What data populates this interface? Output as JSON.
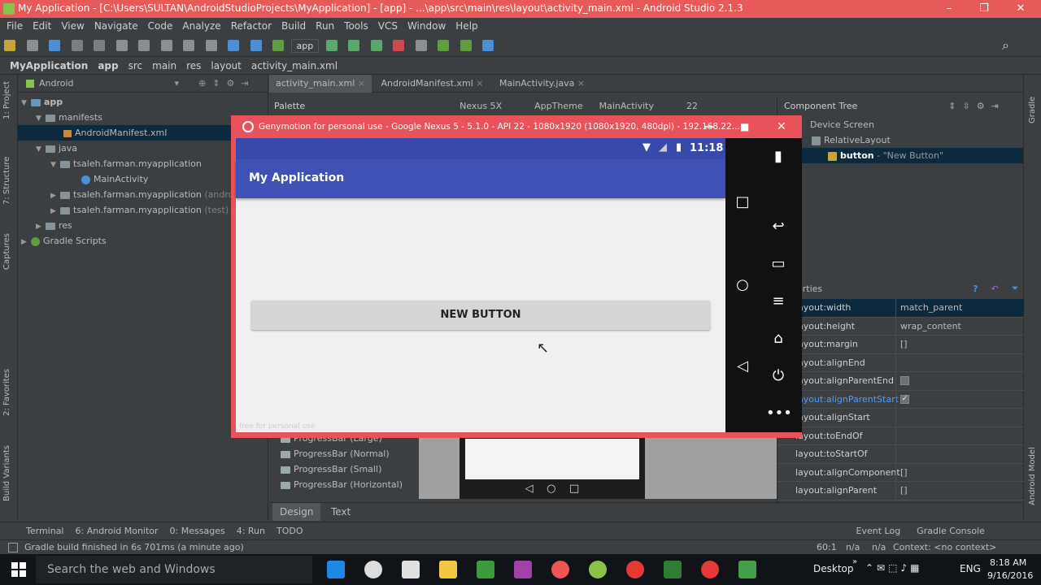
{
  "window": {
    "title": "My Application - [C:\\Users\\SULTAN\\AndroidStudioProjects\\MyApplication] - [app] - ...\\app\\src\\main\\res\\layout\\activity_main.xml - Android Studio 2.1.3"
  },
  "menu": [
    "File",
    "Edit",
    "View",
    "Navigate",
    "Code",
    "Analyze",
    "Refactor",
    "Build",
    "Run",
    "Tools",
    "VCS",
    "Window",
    "Help"
  ],
  "toolbar": {
    "run_config": "app"
  },
  "breadcrumb": [
    "MyApplication",
    "app",
    "src",
    "main",
    "res",
    "layout",
    "activity_main.xml"
  ],
  "left_tabs": [
    "1: Project",
    "7: Structure",
    "Captures",
    "2: Favorites",
    "Build Variants"
  ],
  "right_tabs": [
    "Gradle",
    "Android Model"
  ],
  "project": {
    "view_label": "Android",
    "tree": [
      {
        "label": "app",
        "extra": ""
      },
      {
        "label": "manifests",
        "extra": ""
      },
      {
        "label": "AndroidManifest.xml",
        "extra": ""
      },
      {
        "label": "java",
        "extra": ""
      },
      {
        "label": "tsaleh.farman.myapplication",
        "extra": ""
      },
      {
        "label": "MainActivity",
        "extra": ""
      },
      {
        "label": "tsaleh.farman.myapplication",
        "extra": "(androi"
      },
      {
        "label": "tsaleh.farman.myapplication",
        "extra": "(test)"
      },
      {
        "label": "res",
        "extra": ""
      },
      {
        "label": "Gradle Scripts",
        "extra": ""
      }
    ]
  },
  "editor_tabs": [
    {
      "label": "activity_main.xml"
    },
    {
      "label": "AndroidManifest.xml"
    },
    {
      "label": "MainActivity.java"
    }
  ],
  "palette": {
    "title": "Palette",
    "device": "Nexus 5X",
    "theme": "AppTheme",
    "activity": "MainActivity",
    "api": "22",
    "items": [
      "ProgressBar (Large)",
      "ProgressBar (Normal)",
      "ProgressBar (Small)",
      "ProgressBar (Horizontal)"
    ]
  },
  "component_tree": {
    "title": "Component Tree",
    "nodes": [
      "Device Screen",
      "RelativeLayout",
      "button",
      "- \"New Button\""
    ]
  },
  "properties": {
    "title": "erties",
    "rows": [
      {
        "key": "layout:width",
        "value": "match_parent"
      },
      {
        "key": "layout:height",
        "value": "wrap_content"
      },
      {
        "key": "layout:margin",
        "value": "[]"
      },
      {
        "key": "layout:alignEnd",
        "value": ""
      },
      {
        "key": "layout:alignParentEnd",
        "value": ""
      },
      {
        "key": "layout:alignParentStart",
        "value": ""
      },
      {
        "key": "layout:alignStart",
        "value": ""
      },
      {
        "key": "layout:toEndOf",
        "value": ""
      },
      {
        "key": "layout:toStartOf",
        "value": ""
      },
      {
        "key": "layout:alignComponent",
        "value": "[]"
      },
      {
        "key": "layout:alignParent",
        "value": "[]"
      }
    ]
  },
  "design_tabs": [
    "Design",
    "Text"
  ],
  "bottom_tools": [
    "Terminal",
    "6: Android Monitor",
    "0: Messages",
    "4: Run",
    "TODO",
    "Event Log",
    "Gradle Console"
  ],
  "status": {
    "message": "Gradle build finished in 6s 701ms (a minute ago)",
    "position": "60:1",
    "na1": "n/a",
    "na2": "n/a",
    "context": "Context: <no context>"
  },
  "genymotion": {
    "title": "Genymotion for personal use - Google Nexus 5 - 5.1.0 - API 22 - 1080x1920 (1080x1920, 480dpi) - 192.168.22...",
    "time": "11:18",
    "app_title": "My Application",
    "button_label": "NEW BUTTON",
    "watermark": "free for personal use"
  },
  "taskbar": {
    "search": "Search the web and Windows",
    "desktop": "Desktop",
    "lang": "ENG",
    "time": "8:18 AM",
    "date": "9/16/2016"
  },
  "colors": {
    "accent": "#3f51b5",
    "title_bar": "#e65a5a",
    "geny_frame": "#e8525a"
  }
}
